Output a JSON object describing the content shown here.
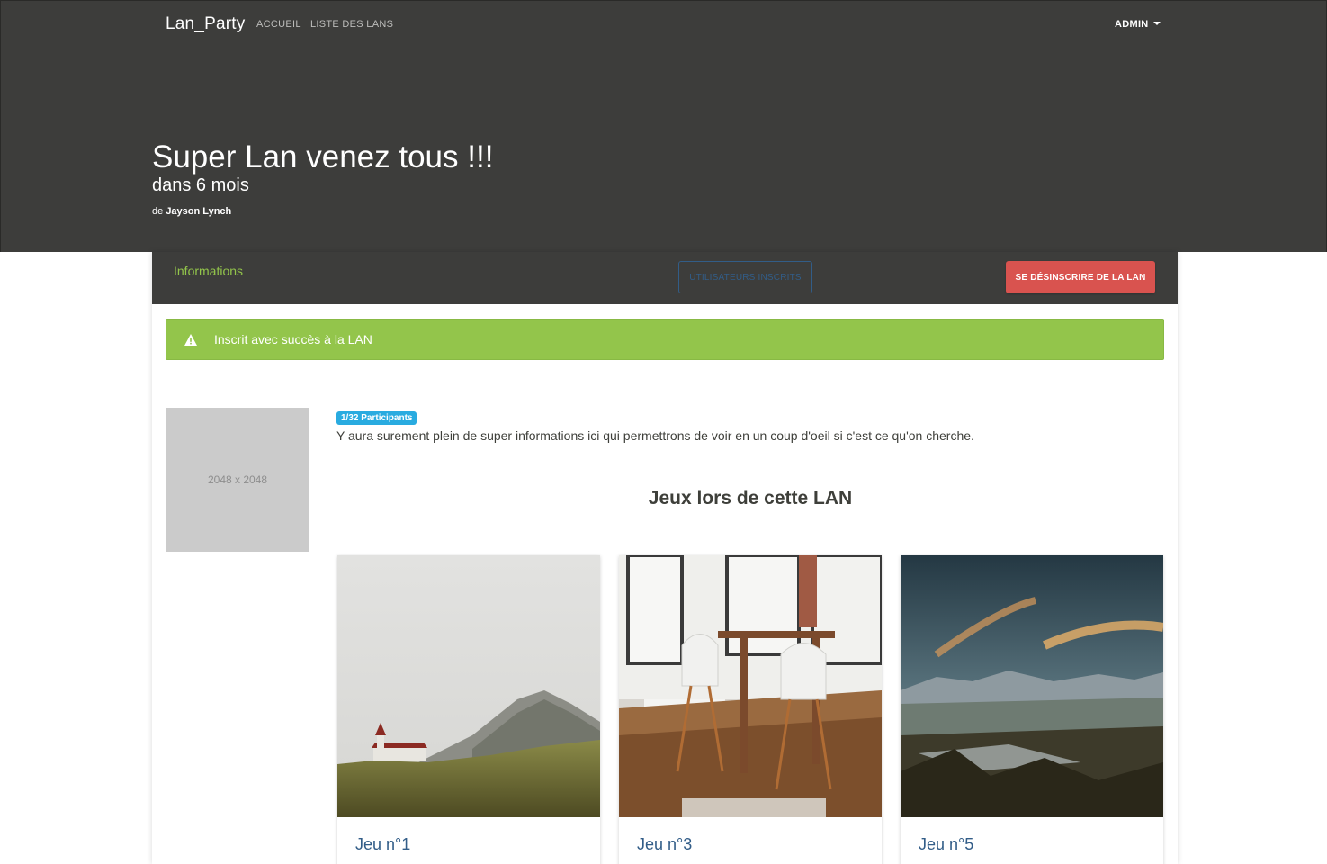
{
  "navbar": {
    "brand": "Lan_Party",
    "links": [
      "ACCUEIL",
      "LISTE DES LANS"
    ],
    "user_menu": "ADMIN"
  },
  "hero": {
    "title": "Super Lan venez tous !!!",
    "subtitle": "dans 6 mois",
    "author_prefix": "de",
    "author_name": "Jayson Lynch"
  },
  "card_header": {
    "tab_label": "Informations",
    "users_button": "UTILISATEURS INSCRITS",
    "unsubscribe_button": "SE DÉSINSCRIRE DE LA LAN"
  },
  "alert": {
    "icon": "warning-icon",
    "message": "Inscrit avec succès à la LAN"
  },
  "lan": {
    "image_placeholder": "2048 x 2048",
    "participants_badge": "1/32 Participants",
    "description": "Y aura surement plein de super informations ici qui permettrons de voir en un coup d'oeil si c'est ce qu'on cherche."
  },
  "games": {
    "title": "Jeux lors de cette LAN",
    "items": [
      {
        "name": "Jeu n°1",
        "image": "landscape-church-photo"
      },
      {
        "name": "Jeu n°3",
        "image": "dining-room-chairs-photo"
      },
      {
        "name": "Jeu n°5",
        "image": "mountain-sunset-photo"
      }
    ]
  },
  "colors": {
    "navbar_bg": "#3d3d3b",
    "success": "#93c54b",
    "primary": "#325d88",
    "danger": "#d9534f",
    "info": "#29abe0"
  }
}
